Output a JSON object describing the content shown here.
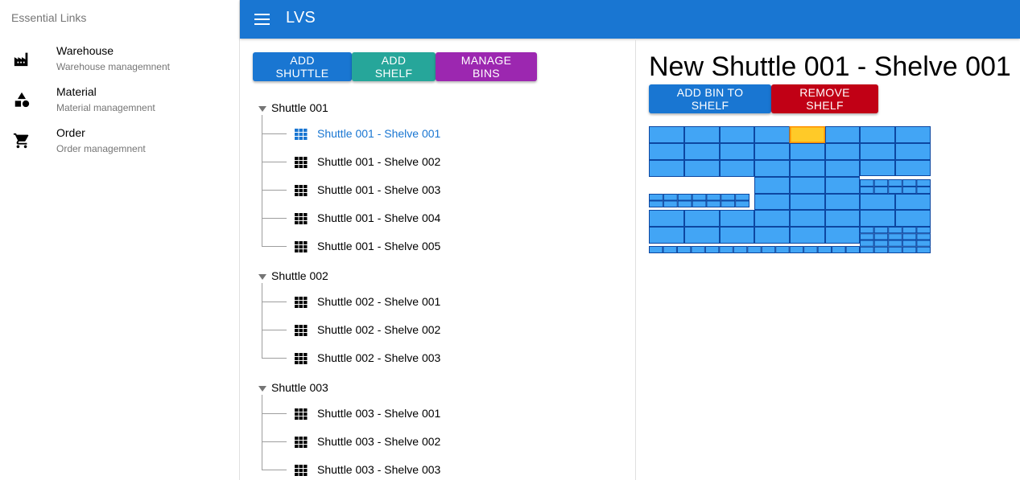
{
  "drawer": {
    "header": "Essential Links",
    "items": [
      {
        "title": "Warehouse",
        "caption": "Warehouse managemnent",
        "icon": "factory-icon"
      },
      {
        "title": "Material",
        "caption": "Material managemnent",
        "icon": "category-shapes-icon"
      },
      {
        "title": "Order",
        "caption": "Order managemnent",
        "icon": "shopping-cart-icon"
      }
    ]
  },
  "appbar": {
    "title": "LVS",
    "menu_icon": "menu-icon"
  },
  "toolbar": {
    "add_shuttle": "ADD SHUTTLE",
    "add_shelf": "ADD SHELF",
    "manage_bins": "MANAGE BINS"
  },
  "tree": [
    {
      "label": "Shuttle 001",
      "children": [
        "Shuttle 001 - Shelve 001",
        "Shuttle 001 - Shelve 002",
        "Shuttle 001 - Shelve 003",
        "Shuttle 001 - Shelve 004",
        "Shuttle 001 - Shelve 005"
      ]
    },
    {
      "label": "Shuttle 002",
      "children": [
        "Shuttle 002 - Shelve 001",
        "Shuttle 002 - Shelve 002",
        "Shuttle 002 - Shelve 003"
      ]
    },
    {
      "label": "Shuttle 003",
      "children": [
        "Shuttle 003 - Shelve 001",
        "Shuttle 003 - Shelve 002",
        "Shuttle 003 - Shelve 003"
      ]
    }
  ],
  "selected_shelf": "Shuttle 001 - Shelve 001",
  "shelf_panel": {
    "title": "New Shuttle 001 - Shelve 001",
    "add_bin": "ADD BIN TO SHELF",
    "remove_shelf": "REMOVE SHELF"
  },
  "colors": {
    "primary": "#1976d2",
    "teal": "#26a69a",
    "purple": "#9c27b0",
    "negative": "#c10015",
    "bin_fill": "#42a5f5",
    "bin_border": "#0d47a1",
    "bin_selected": "#ffca28"
  }
}
